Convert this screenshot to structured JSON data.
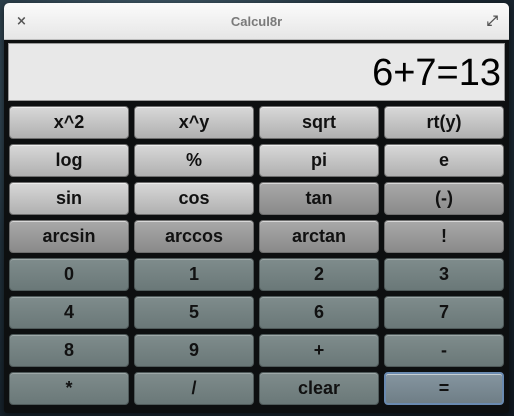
{
  "window": {
    "title": "Calcul8r"
  },
  "titlebar": {
    "close_icon": "×",
    "maximize_icon": "⤢"
  },
  "display": {
    "text": "6+7=13"
  },
  "keys": [
    {
      "label": "x^2",
      "style": "light"
    },
    {
      "label": "x^y",
      "style": "light"
    },
    {
      "label": "sqrt",
      "style": "light"
    },
    {
      "label": "rt(y)",
      "style": "light"
    },
    {
      "label": "log",
      "style": "light"
    },
    {
      "label": "%",
      "style": "light"
    },
    {
      "label": "pi",
      "style": "light"
    },
    {
      "label": "e",
      "style": "light"
    },
    {
      "label": "sin",
      "style": "light"
    },
    {
      "label": "cos",
      "style": "light"
    },
    {
      "label": "tan",
      "style": "mid"
    },
    {
      "label": "(-)",
      "style": "mid"
    },
    {
      "label": "arcsin",
      "style": "mid"
    },
    {
      "label": "arccos",
      "style": "mid"
    },
    {
      "label": "arctan",
      "style": "mid"
    },
    {
      "label": "!",
      "style": "mid"
    },
    {
      "label": "0",
      "style": "dark"
    },
    {
      "label": "1",
      "style": "dark"
    },
    {
      "label": "2",
      "style": "dark"
    },
    {
      "label": "3",
      "style": "dark"
    },
    {
      "label": "4",
      "style": "dark"
    },
    {
      "label": "5",
      "style": "dark"
    },
    {
      "label": "6",
      "style": "dark"
    },
    {
      "label": "7",
      "style": "dark"
    },
    {
      "label": "8",
      "style": "dark"
    },
    {
      "label": "9",
      "style": "dark"
    },
    {
      "label": "+",
      "style": "dark"
    },
    {
      "label": "-",
      "style": "dark"
    },
    {
      "label": "*",
      "style": "dark"
    },
    {
      "label": "/",
      "style": "dark"
    },
    {
      "label": "clear",
      "style": "dark"
    },
    {
      "label": "=",
      "style": "focus"
    }
  ],
  "colors": {
    "light_key": "#c4c4c4",
    "mid_key": "#999999",
    "dark_key": "#748282",
    "focus_border": "#6a8ab0",
    "display_bg": "#e8e8e8"
  }
}
